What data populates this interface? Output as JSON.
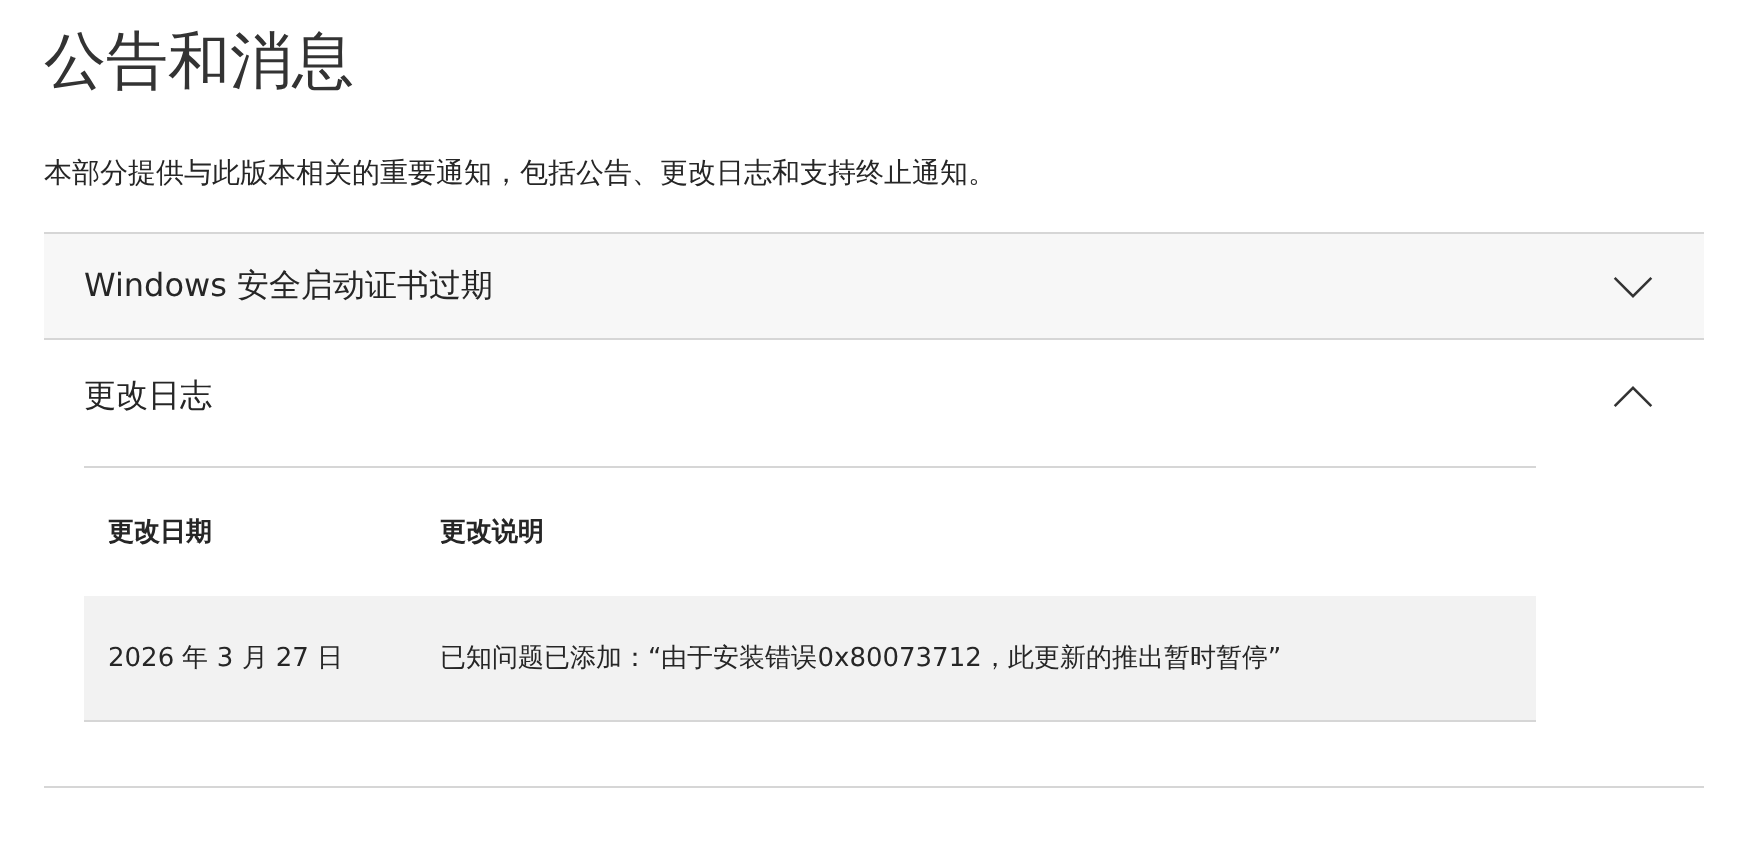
{
  "title": "公告和消息",
  "description": "本部分提供与此版本相关的重要通知，包括公告、更改日志和支持终止通知。",
  "sections": [
    {
      "title": "Windows 安全启动证书过期",
      "expanded": false
    },
    {
      "title": "更改日志",
      "expanded": true,
      "table": {
        "columns": [
          "更改日期",
          "更改说明"
        ],
        "rows": [
          [
            "2026 年 3 月 27 日",
            "已知问题已添加：“由于安装错误0x80073712，此更新的推出暂时暂停”"
          ]
        ]
      }
    }
  ]
}
